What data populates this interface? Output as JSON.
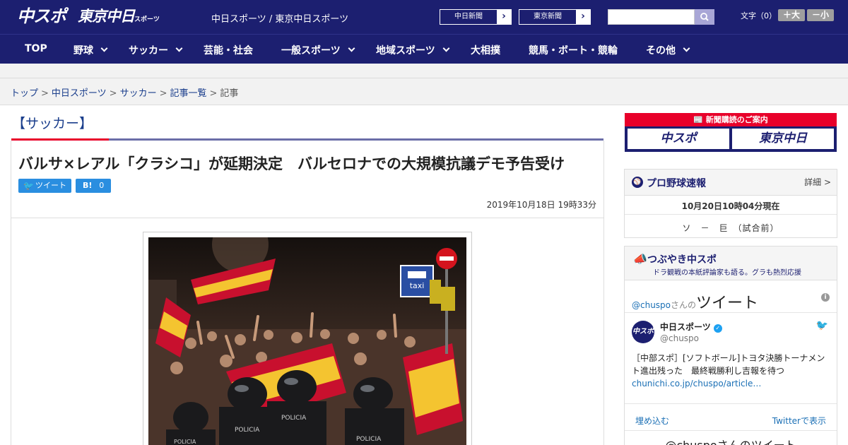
{
  "header": {
    "logo_chuspo": "中スポ",
    "logo_tokyo": "東京中日",
    "logo_tokyo_small": "スポーツ",
    "site_links": "中日スポーツ / 東京中日スポーツ",
    "chunichi_news": "中日新聞",
    "tokyo_news": "東京新聞",
    "font_size_label": "文字（0）",
    "font_bigger": "＋大",
    "font_smaller": "－小"
  },
  "nav": {
    "items": [
      {
        "label": "TOP"
      },
      {
        "label": "野球"
      },
      {
        "label": "サッカー"
      },
      {
        "label": "芸能・社会"
      },
      {
        "label": "一般スポーツ"
      },
      {
        "label": "地域スポーツ"
      },
      {
        "label": "大相撲"
      },
      {
        "label": "競馬・ボート・競輪"
      },
      {
        "label": "その他"
      }
    ]
  },
  "breadcrumb": {
    "items": [
      "トップ",
      "中日スポーツ",
      "サッカー",
      "記事一覧"
    ],
    "current": "記事",
    "separator": ">"
  },
  "article": {
    "category": "【サッカー】",
    "title": "バルサ×レアル「クラシコ」が延期決定　バルセロナでの大規模抗議デモ予告受け",
    "tweet_label": "ツイート",
    "hatena_label": "B!",
    "hatena_count": "0",
    "date": "2019年10月18日 19時33分",
    "photo_sign": "taxi",
    "police_text": "POLICIA"
  },
  "sidebar": {
    "subscription": {
      "title": "新聞購読のご案内",
      "chuspo": "中スポ",
      "tokyo": "東京中日"
    },
    "baseball": {
      "title": "プロ野球速報",
      "detail": "詳細 >",
      "time": "10月20日10時04分現在",
      "game": "ソ　－　巨　（試合前）"
    },
    "tweets": {
      "title": "つぶやき中スポ",
      "subtitle": "ドラ観戦の本紙評論家も語る。グラも熱烈応援",
      "handle_prefix": "@chuspo",
      "handle_small": "さんの",
      "handle_big": "ツイート",
      "account_name": "中日スポーツ",
      "account_handle": "@chuspo",
      "avatar_text": "中スポ",
      "tweet_text": "［中部スポ］[ソフトボール]トヨタ決勝トーナメント進出残った　最終戦勝利し吉報を待つ",
      "tweet_link": "chunichi.co.jp/chuspo/article…",
      "embed": "埋め込む",
      "view_on_twitter": "Twitterで表示",
      "footer": "@chuspoさんのツイート"
    }
  },
  "colors": {
    "brand_navy": "#1c1f70",
    "accent_red": "#e8002a",
    "twitter_blue": "#2a8ee0",
    "link_blue": "#1a3e8c"
  }
}
